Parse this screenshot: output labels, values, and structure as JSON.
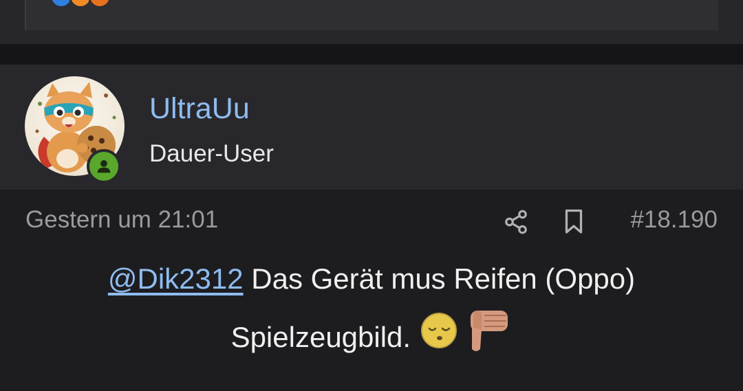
{
  "previous_post": {
    "reactions": [
      "like-reaction",
      "laugh-reaction",
      "wow-reaction"
    ],
    "cut_text": "…"
  },
  "user": {
    "name": "UltraUu",
    "role": "Dauer-User",
    "online": true,
    "avatar": "cat-superhero-with-cookie-avatar"
  },
  "post": {
    "timestamp": "Gestern um 21:01",
    "number": "#18.190",
    "mention": "@Dik2312",
    "text_after_mention": " Das Gerät mus Reifen (Oppo)",
    "text_line2": "Spielzeugbild.",
    "emojis": [
      "sleepy-face-emoji",
      "thumbs-down-emoji"
    ]
  },
  "icons": {
    "share": "share-icon",
    "bookmark": "bookmark-icon",
    "online": "user-online-icon"
  },
  "colors": {
    "accent_link": "#8fbcf0",
    "online_badge": "#59a82c",
    "background": "#1d1d20",
    "header_bg": "#28282c"
  }
}
